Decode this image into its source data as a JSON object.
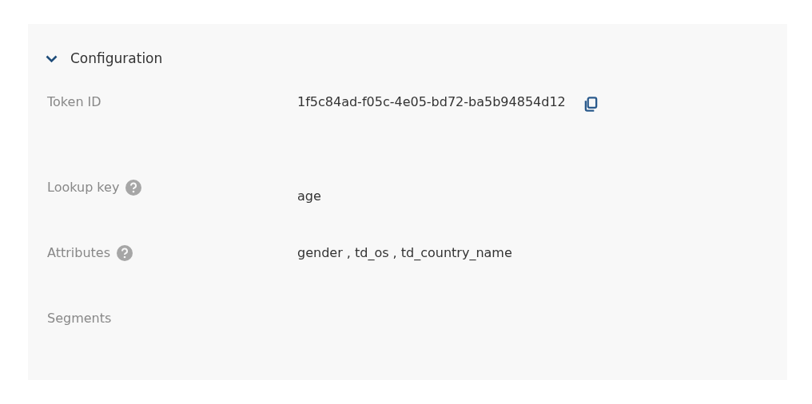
{
  "section": {
    "title": "Configuration",
    "expanded": true
  },
  "fields": [
    {
      "label": "Token ID",
      "help": false,
      "value": "1f5c84ad-f05c-4e05-bd72-ba5b94854d12",
      "copyable": true
    },
    {
      "label": "Lookup key",
      "help": true,
      "value": "age",
      "copyable": false
    },
    {
      "label": "Attributes",
      "help": true,
      "value": "gender , td_os , td_country_name",
      "copyable": false
    },
    {
      "label": "Segments",
      "help": false,
      "copyable": false
    }
  ]
}
